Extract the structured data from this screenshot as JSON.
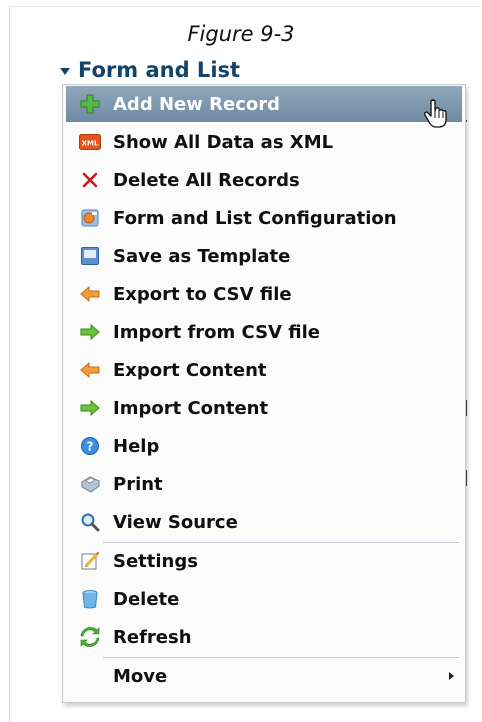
{
  "caption": "Figure 9-3",
  "module": {
    "title": "Form and List"
  },
  "menu": {
    "items": [
      {
        "label": "Add New Record",
        "icon": "add-icon"
      },
      {
        "label": "Show All Data as XML",
        "icon": "xml-icon"
      },
      {
        "label": "Delete All Records",
        "icon": "delete-x-icon"
      },
      {
        "label": "Form and List Configuration",
        "icon": "configuration-icon"
      },
      {
        "label": "Save as Template",
        "icon": "template-icon"
      },
      {
        "label": "Export to CSV file",
        "icon": "export-arrow-icon"
      },
      {
        "label": "Import from CSV file",
        "icon": "import-arrow-icon"
      },
      {
        "label": "Export Content",
        "icon": "export-arrow-icon"
      },
      {
        "label": "Import Content",
        "icon": "import-arrow-icon"
      },
      {
        "label": "Help",
        "icon": "help-icon"
      },
      {
        "label": "Print",
        "icon": "print-icon"
      },
      {
        "label": "View Source",
        "icon": "magnifier-icon"
      },
      {
        "label": "Settings",
        "icon": "settings-icon"
      },
      {
        "label": "Delete",
        "icon": "trash-icon"
      },
      {
        "label": "Refresh",
        "icon": "refresh-icon"
      },
      {
        "label": "Move",
        "icon": ""
      }
    ]
  },
  "colors": {
    "highlight": "#7f98ae",
    "title": "#13426b"
  }
}
